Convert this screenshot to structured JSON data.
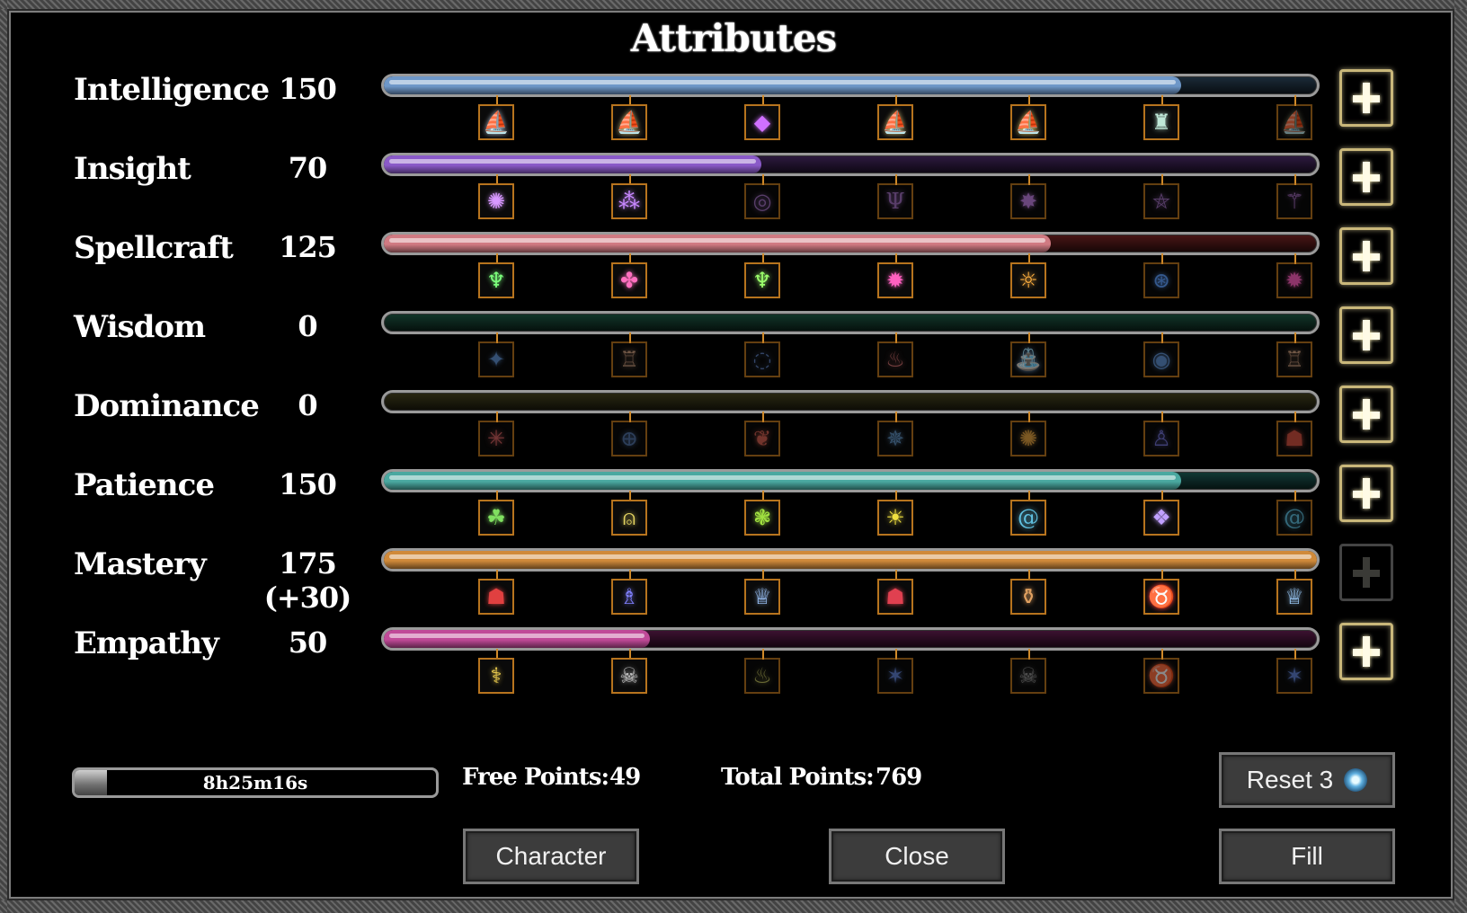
{
  "title": "Attributes",
  "attributes": [
    {
      "name": "Intelligence",
      "value": "150",
      "progress": 0.855,
      "color": "#6e97c8",
      "track": "#1c2c3a",
      "milestones": [
        {
          "icon": "ship-icon",
          "g": "⛵",
          "c": "#b8c4d6",
          "on": true
        },
        {
          "icon": "ship-icon",
          "g": "⛵",
          "c": "#d8c07a",
          "on": true
        },
        {
          "icon": "crystal-icon",
          "g": "◆",
          "c": "#d070ff",
          "on": true
        },
        {
          "icon": "ship-icon",
          "g": "⛵",
          "c": "#d8c07a",
          "on": true
        },
        {
          "icon": "ship-icon",
          "g": "⛵",
          "c": "#e0c060",
          "on": true
        },
        {
          "icon": "tower-icon",
          "g": "♜",
          "c": "#bfe8d8",
          "on": true
        },
        {
          "icon": "ship-icon",
          "g": "⛵",
          "c": "#9a9a70",
          "on": false
        }
      ]
    },
    {
      "name": "Insight",
      "value": "70",
      "progress": 0.405,
      "color": "#8a5ac8",
      "track": "#2e1a40",
      "milestones": [
        {
          "icon": "rune-icon",
          "g": "✺",
          "c": "#d898ff",
          "on": true
        },
        {
          "icon": "orbs-icon",
          "g": "⁂",
          "c": "#c888ff",
          "on": true
        },
        {
          "icon": "portal-icon",
          "g": "◎",
          "c": "#a070c0",
          "on": false
        },
        {
          "icon": "trident-icon",
          "g": "Ψ",
          "c": "#a070c0",
          "on": false
        },
        {
          "icon": "star-icon",
          "g": "✸",
          "c": "#c080e0",
          "on": false
        },
        {
          "icon": "pentagram-icon",
          "g": "⛤",
          "c": "#a070c0",
          "on": false
        },
        {
          "icon": "staff-icon",
          "g": "⚚",
          "c": "#c080e0",
          "on": false
        }
      ]
    },
    {
      "name": "Spellcraft",
      "value": "125",
      "progress": 0.715,
      "color": "#d07a82",
      "track": "#4a1616",
      "milestones": [
        {
          "icon": "figure-icon",
          "g": "♆",
          "c": "#7cff7c",
          "on": true
        },
        {
          "icon": "swirl-icon",
          "g": "✤",
          "c": "#ff70c0",
          "on": true
        },
        {
          "icon": "figure-icon",
          "g": "♆",
          "c": "#9cff6c",
          "on": true
        },
        {
          "icon": "burst-icon",
          "g": "✹",
          "c": "#ff60c0",
          "on": true
        },
        {
          "icon": "sun-icon",
          "g": "☼",
          "c": "#ffb040",
          "on": true
        },
        {
          "icon": "vortex-icon",
          "g": "⊛",
          "c": "#60a0ff",
          "on": false
        },
        {
          "icon": "burst-icon",
          "g": "✹",
          "c": "#ff60c0",
          "on": false
        }
      ]
    },
    {
      "name": "Wisdom",
      "value": "0",
      "progress": 0.0,
      "color": "#2e6048",
      "track": "#12372a",
      "milestones": [
        {
          "icon": "star-icon",
          "g": "✦",
          "c": "#6090d0",
          "on": false
        },
        {
          "icon": "totem-icon",
          "g": "♖",
          "c": "#d0a080",
          "on": false
        },
        {
          "icon": "ripple-icon",
          "g": "◌",
          "c": "#6080c0",
          "on": false
        },
        {
          "icon": "flame-icon",
          "g": "♨",
          "c": "#d07070",
          "on": false
        },
        {
          "icon": "fountain-icon",
          "g": "⛲",
          "c": "#70a0d0",
          "on": false
        },
        {
          "icon": "orb-icon",
          "g": "◉",
          "c": "#6090d0",
          "on": false
        },
        {
          "icon": "totem-icon",
          "g": "♖",
          "c": "#d0a080",
          "on": false
        }
      ]
    },
    {
      "name": "Dominance",
      "value": "0",
      "progress": 0.0,
      "color": "#4a4620",
      "track": "#2a2812",
      "milestones": [
        {
          "icon": "spark-icon",
          "g": "✳",
          "c": "#d06060",
          "on": false
        },
        {
          "icon": "target-icon",
          "g": "⊕",
          "c": "#5070a0",
          "on": false
        },
        {
          "icon": "tree-icon",
          "g": "❦",
          "c": "#d06050",
          "on": false
        },
        {
          "icon": "compass-icon",
          "g": "✵",
          "c": "#6090c0",
          "on": false
        },
        {
          "icon": "burst-icon",
          "g": "✺",
          "c": "#e0a040",
          "on": false
        },
        {
          "icon": "figure-icon",
          "g": "♙",
          "c": "#7070d0",
          "on": false
        },
        {
          "icon": "demon-icon",
          "g": "☗",
          "c": "#d05040",
          "on": false
        }
      ]
    },
    {
      "name": "Patience",
      "value": "150",
      "progress": 0.855,
      "color": "#4aa8a0",
      "track": "#123a36",
      "milestones": [
        {
          "icon": "slime-icon",
          "g": "☘",
          "c": "#80e060",
          "on": true
        },
        {
          "icon": "cage-icon",
          "g": "⍝",
          "c": "#e0d060",
          "on": true
        },
        {
          "icon": "cells-icon",
          "g": "❃",
          "c": "#a0e040",
          "on": true
        },
        {
          "icon": "sun-icon",
          "g": "☀",
          "c": "#f0e040",
          "on": true
        },
        {
          "icon": "spiral-icon",
          "g": "@",
          "c": "#60c0e0",
          "on": true
        },
        {
          "icon": "gems-icon",
          "g": "❖",
          "c": "#c0a0ff",
          "on": true
        },
        {
          "icon": "spiral-icon",
          "g": "@",
          "c": "#60c0e0",
          "on": false
        }
      ]
    },
    {
      "name": "Mastery",
      "value": "175 (+30)",
      "progress": 1.0,
      "color": "#d08a3a",
      "track": "#4a2a10",
      "milestones": [
        {
          "icon": "hood-icon",
          "g": "☗",
          "c": "#e04040",
          "on": true
        },
        {
          "icon": "mage-icon",
          "g": "♗",
          "c": "#8080ff",
          "on": true
        },
        {
          "icon": "wizard-icon",
          "g": "♕",
          "c": "#a0c8ff",
          "on": true
        },
        {
          "icon": "hood-icon",
          "g": "☗",
          "c": "#e04050",
          "on": true
        },
        {
          "icon": "bottle-icon",
          "g": "⚱",
          "c": "#e0a060",
          "on": true
        },
        {
          "icon": "demon-icon",
          "g": "♉",
          "c": "#ff4040",
          "on": true
        },
        {
          "icon": "wizard-icon",
          "g": "♕",
          "c": "#a0d0ff",
          "on": true
        }
      ]
    },
    {
      "name": "Empathy",
      "value": "50",
      "progress": 0.285,
      "color": "#c04a98",
      "track": "#3e1232",
      "milestones": [
        {
          "icon": "bone-icon",
          "g": "⚕",
          "c": "#f0d050",
          "on": true
        },
        {
          "icon": "skull-icon",
          "g": "☠",
          "c": "#c0c0c0",
          "on": true
        },
        {
          "icon": "ghost-icon",
          "g": "♨",
          "c": "#c0c060",
          "on": false
        },
        {
          "icon": "spider-icon",
          "g": "✶",
          "c": "#6080d0",
          "on": false
        },
        {
          "icon": "skull-icon",
          "g": "☠",
          "c": "#909090",
          "on": false
        },
        {
          "icon": "demon-icon",
          "g": "♉",
          "c": "#d06040",
          "on": false
        },
        {
          "icon": "spider-icon",
          "g": "✶",
          "c": "#6080d0",
          "on": false
        }
      ]
    }
  ],
  "plus_label": "+",
  "timer": {
    "text": "8h25m16s",
    "progress": 0.09
  },
  "free_points": {
    "label": "Free Points:",
    "value": "49"
  },
  "total_points": {
    "label": "Total Points:",
    "value": "769"
  },
  "buttons": {
    "reset": "Reset 3",
    "character": "Character",
    "close": "Close",
    "fill": "Fill"
  }
}
